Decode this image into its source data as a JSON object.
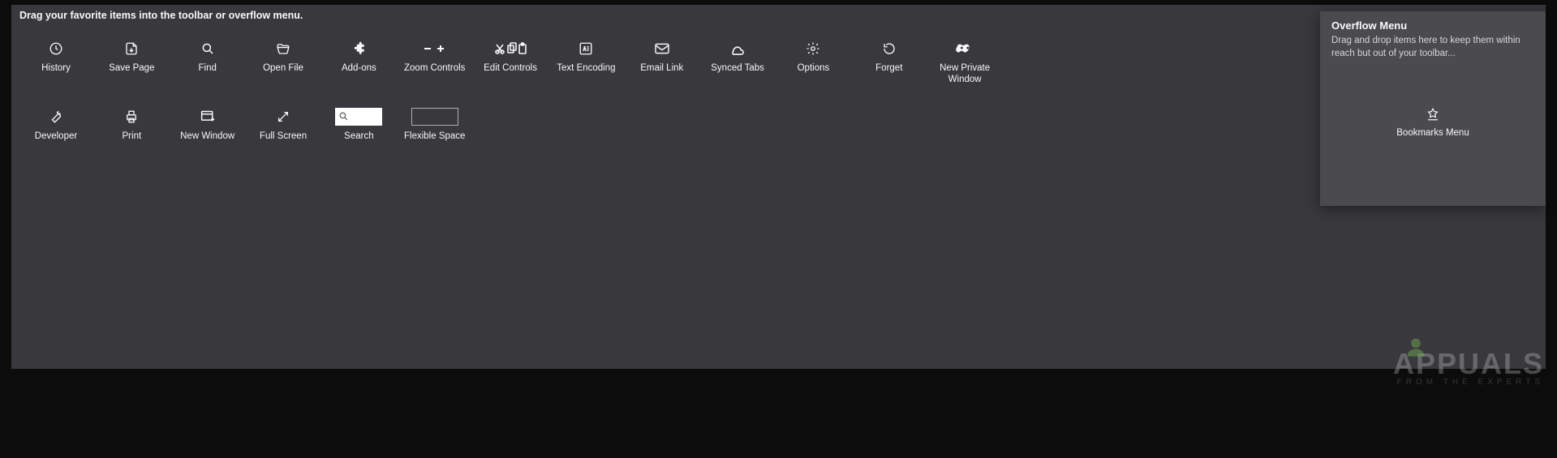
{
  "instruction": "Drag your favorite items into the toolbar or overflow menu.",
  "items": {
    "history": "History",
    "savepage": "Save Page",
    "find": "Find",
    "openfile": "Open File",
    "addons": "Add-ons",
    "zoom": "Zoom Controls",
    "edit": "Edit Controls",
    "encoding": "Text Encoding",
    "email": "Email Link",
    "synced": "Synced Tabs",
    "options": "Options",
    "forget": "Forget",
    "private": "New Private Window",
    "developer": "Developer",
    "print": "Print",
    "newwindow": "New Window",
    "fullscreen": "Full Screen",
    "search": "Search",
    "flexspace": "Flexible Space"
  },
  "overflow": {
    "title": "Overflow Menu",
    "description": "Drag and drop items here to keep them within reach but out of your toolbar...",
    "bookmarks": "Bookmarks Menu"
  },
  "watermark": {
    "main": "APPUALS",
    "sub": "FROM THE EXPERTS"
  }
}
